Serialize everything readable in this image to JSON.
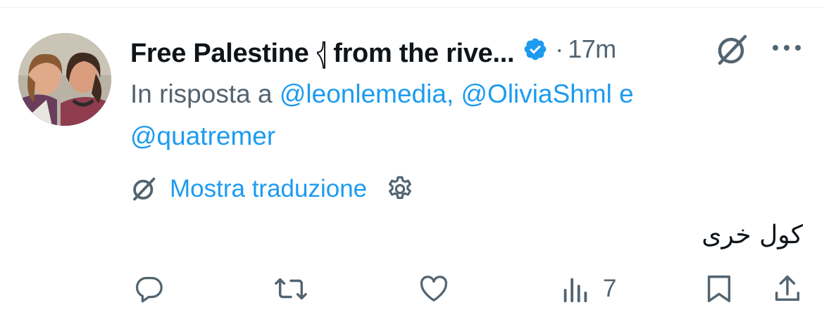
{
  "tweet": {
    "display_name": "Free Palestine 𓂆 from the rive...",
    "separator": "·",
    "time": "17m",
    "reply_prefix": "In risposta a ",
    "mentions": [
      "@leonlemedia",
      "@OliviaShml",
      "@quatremer"
    ],
    "reply_comma": ", ",
    "reply_and": " e",
    "translate_label": "Mostra traduzione",
    "text": "كول خرى",
    "views_count": "7"
  },
  "icons": {
    "verified": "verified-badge-icon",
    "grok": "grok-icon",
    "more": "more-options-icon",
    "settings": "gear-icon",
    "reply": "reply-icon",
    "retweet": "retweet-icon",
    "like": "heart-icon",
    "views": "views-chart-icon",
    "bookmark": "bookmark-icon",
    "share": "share-icon"
  },
  "colors": {
    "accent": "#1d9bf0",
    "text": "#0f1419",
    "muted": "#536471"
  }
}
